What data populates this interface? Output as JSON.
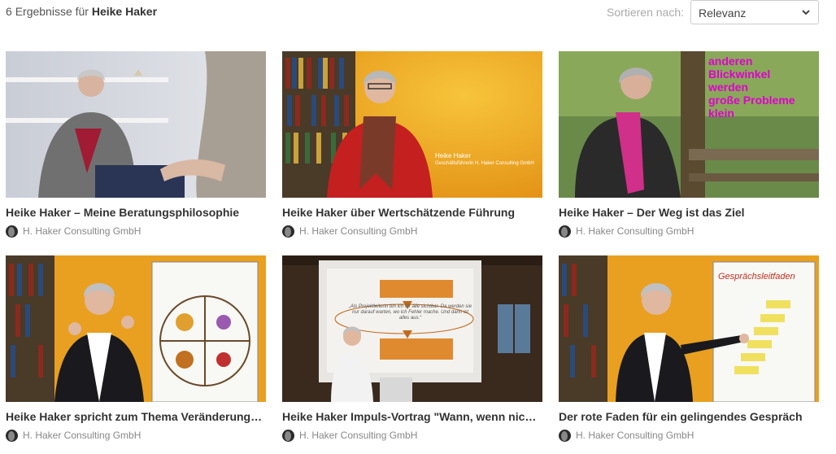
{
  "search": {
    "count": "6",
    "prefix": "Ergebnisse für",
    "query": "Heike Haker"
  },
  "sort": {
    "label": "Sortieren nach:",
    "selected": "Relevanz"
  },
  "videos": [
    {
      "title": "Heike Haker – Meine Beratungsphilosophie",
      "channel": "H. Haker Consulting GmbH"
    },
    {
      "title": "Heike Haker über Wertschätzende Führung",
      "channel": "H. Haker Consulting GmbH",
      "overlay_name": "Heike Haker",
      "overlay_role": "Geschäftsführerin H. Haker Consulting GmbH"
    },
    {
      "title": "Heike Haker – Der Weg ist das Ziel",
      "channel": "H. Haker Consulting GmbH",
      "overlay_lines": [
        "anderen",
        "Blickwinkel",
        "werden",
        "große Probleme",
        "klein"
      ]
    },
    {
      "title": "Heike Haker spricht zum Thema Veränderungsmanagement",
      "channel": "H. Haker Consulting GmbH"
    },
    {
      "title": "Heike Haker Impuls-Vortrag \"Wann, wenn nicht jetzt\"",
      "channel": "H. Haker Consulting GmbH",
      "slide_quote": "„Als Projektleiterin bin ich für alle sichtbar. Da werden sie nur darauf warten, wo ich Fehler mache. Und dann ist alles aus.“"
    },
    {
      "title": "Der rote Faden für ein gelingendes Gespräch",
      "channel": "H. Haker Consulting GmbH",
      "flip_title": "Gesprächsleitfaden"
    }
  ],
  "colors": {
    "title": "#333333",
    "channel": "#888888",
    "accent_magenta": "#e000d0"
  }
}
